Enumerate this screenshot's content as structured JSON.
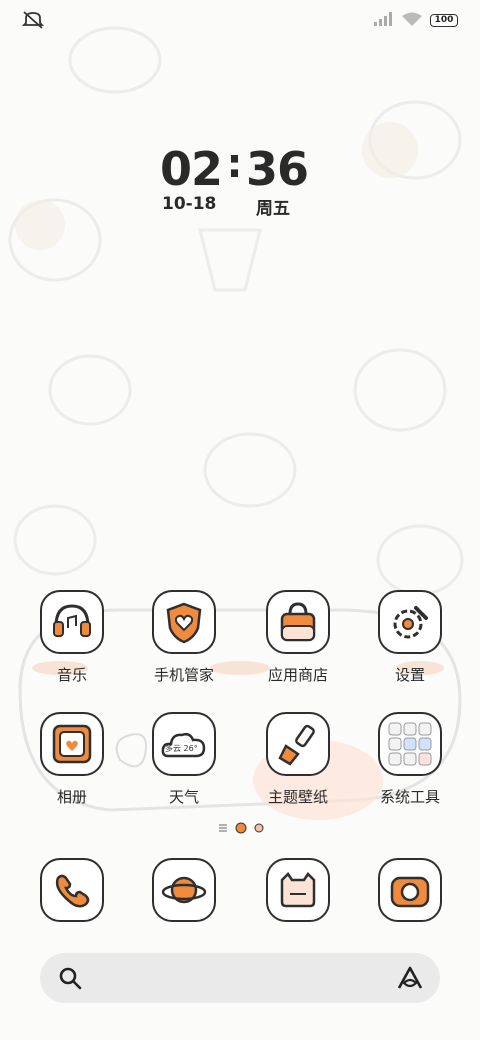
{
  "status_bar": {
    "battery_level": "100",
    "icons": [
      "mute-vibrate-icon",
      "signal-bars-icon",
      "wifi-icon",
      "battery-icon"
    ]
  },
  "clock": {
    "hour": "02",
    "separator": ":",
    "minute": "36",
    "date": "10-18",
    "weekday": "周五"
  },
  "apps_row1": [
    {
      "label": "音乐"
    },
    {
      "label": "手机管家"
    },
    {
      "label": "应用商店"
    },
    {
      "label": "设置"
    }
  ],
  "apps_row2": [
    {
      "label": "相册"
    },
    {
      "label": "天气",
      "widget_text": "多云 26°"
    },
    {
      "label": "主题壁纸"
    },
    {
      "label": "系统工具"
    }
  ],
  "dock": {
    "apps": [
      "phone-icon",
      "browser-icon",
      "messages-icon",
      "camera-icon"
    ]
  },
  "search_bar": {
    "icons": [
      "search-icon",
      "assistant-icon"
    ]
  },
  "colors": {
    "accent_orange": "#f08a3c",
    "icon_outline": "#2f2f2f",
    "background": "#fbfbfa"
  }
}
